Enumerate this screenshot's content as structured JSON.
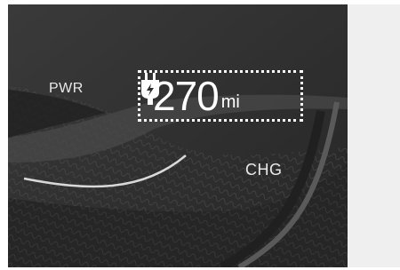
{
  "cluster": {
    "power_label": "PWR",
    "charge_label": "CHG",
    "range": {
      "icon": "ev-plug-icon",
      "value": "270",
      "unit": "mi"
    }
  },
  "colors": {
    "background": "#2e2e2e",
    "text": "#ffffff",
    "side_panel": "#efefef"
  }
}
